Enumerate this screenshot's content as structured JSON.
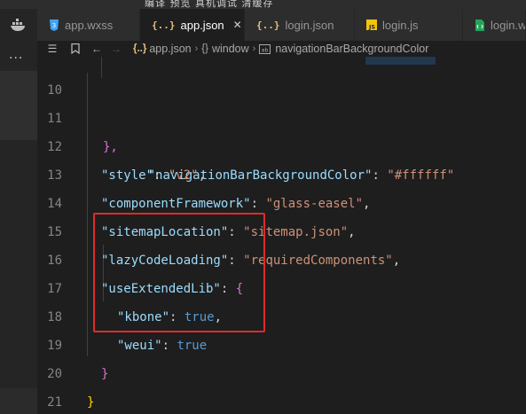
{
  "top_menu": "编译  预览  真机调试  清缓存",
  "tabs": [
    {
      "label": "app.wxss",
      "icon": "css-file-icon",
      "active": false
    },
    {
      "label": "app.json",
      "icon": "json-file-icon",
      "active": true,
      "close": "✕"
    },
    {
      "label": "login.json",
      "icon": "json-file-icon",
      "active": false
    },
    {
      "label": "login.js",
      "icon": "js-file-icon",
      "active": false
    },
    {
      "label": "login.w",
      "icon": "wxml-file-icon",
      "active": false
    }
  ],
  "breadcrumb": {
    "file": "app.json",
    "file_icon": "{..}",
    "node": "window",
    "node_icon": "{}",
    "leaf": "navigationBarBackgroundColor"
  },
  "editor": {
    "lines": [
      {
        "n": "10",
        "key": "navigationBarBackgroundColor",
        "colon": ": ",
        "value": "\"#ffffff\""
      },
      {
        "n": "11",
        "text": "},"
      },
      {
        "n": "12",
        "key": "\"style\"",
        "colon": ": ",
        "value": "\"v2\"",
        "tail": ","
      },
      {
        "n": "13",
        "key": "\"componentFramework\"",
        "colon": ": ",
        "value": "\"glass-easel\"",
        "tail": ","
      },
      {
        "n": "14",
        "key": "\"sitemapLocation\"",
        "colon": ": ",
        "value": "\"sitemap.json\"",
        "tail": ","
      },
      {
        "n": "15",
        "key": "\"lazyCodeLoading\"",
        "colon": ": ",
        "value": "\"requiredComponents\"",
        "tail": ","
      },
      {
        "n": "16",
        "key": "\"useExtendedLib\"",
        "colon": ": ",
        "value": "{"
      },
      {
        "n": "17",
        "key": "\"kbone\"",
        "colon": ": ",
        "value": "true",
        "tail": ","
      },
      {
        "n": "18",
        "key": "\"weui\"",
        "colon": ": ",
        "value": "true"
      },
      {
        "n": "19",
        "text": "}"
      },
      {
        "n": "20",
        "text": "}"
      },
      {
        "n": "21",
        "text": ""
      }
    ]
  },
  "colors": {
    "background": "#1e1e1e",
    "key": "#9cdcfe",
    "string": "#ce9178",
    "literal": "#569cd6",
    "highlight_box": "#e02b2b"
  }
}
